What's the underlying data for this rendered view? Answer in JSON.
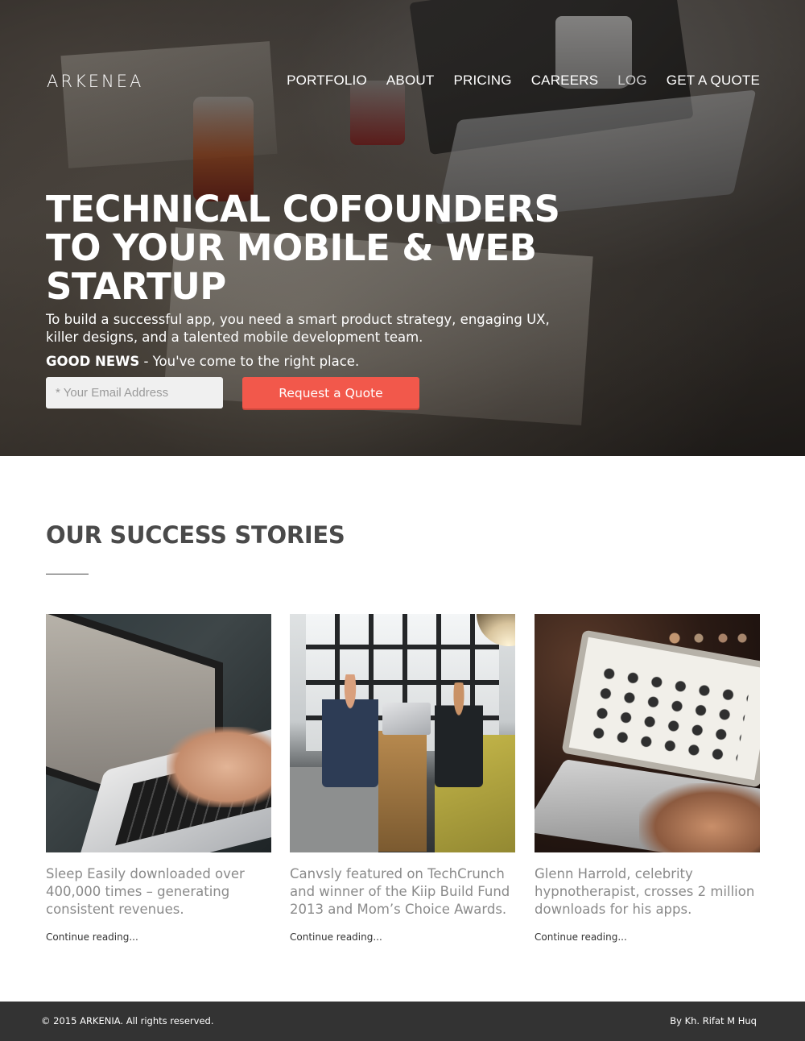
{
  "header": {
    "logo": "ARKENEA",
    "nav": [
      {
        "label": "PORTFOLIO"
      },
      {
        "label": "ABOUT"
      },
      {
        "label": "PRICING"
      },
      {
        "label": "CAREERS"
      },
      {
        "label": "LOG"
      },
      {
        "label": "GET A QUOTE"
      }
    ]
  },
  "hero": {
    "title": "TECHNICAL COFOUNDERS TO YOUR MOBILE & WEB STARTUP",
    "description": "To build a successful app, you need a smart product strategy, engaging UX, killer designs, and a talented mobile development team.",
    "news_label": "GOOD NEWS",
    "news_text": " - You've come to the right place.",
    "email_placeholder": "* Your Email Address",
    "cta_label": "Request a Quote",
    "cta_color": "#f2584b"
  },
  "stories": {
    "title": "OUR SUCCESS STORIES",
    "items": [
      {
        "text": "Sleep Easily downloaded over 400,000 times – generating consistent revenues.",
        "link": "Continue reading..."
      },
      {
        "text": "Canvsly featured on TechCrunch and winner of the Kiip Build Fund 2013 and Mom’s Choice Awards.",
        "link": "Continue reading..."
      },
      {
        "text": "Glenn Harrold, celebrity hypnotherapist, crosses 2 million downloads for his apps.",
        "link": "Continue reading..."
      }
    ]
  },
  "footer": {
    "copyright": "© 2015 ARKENIA. All rights reserved.",
    "credit": "By Kh. Rifat M Huq"
  }
}
